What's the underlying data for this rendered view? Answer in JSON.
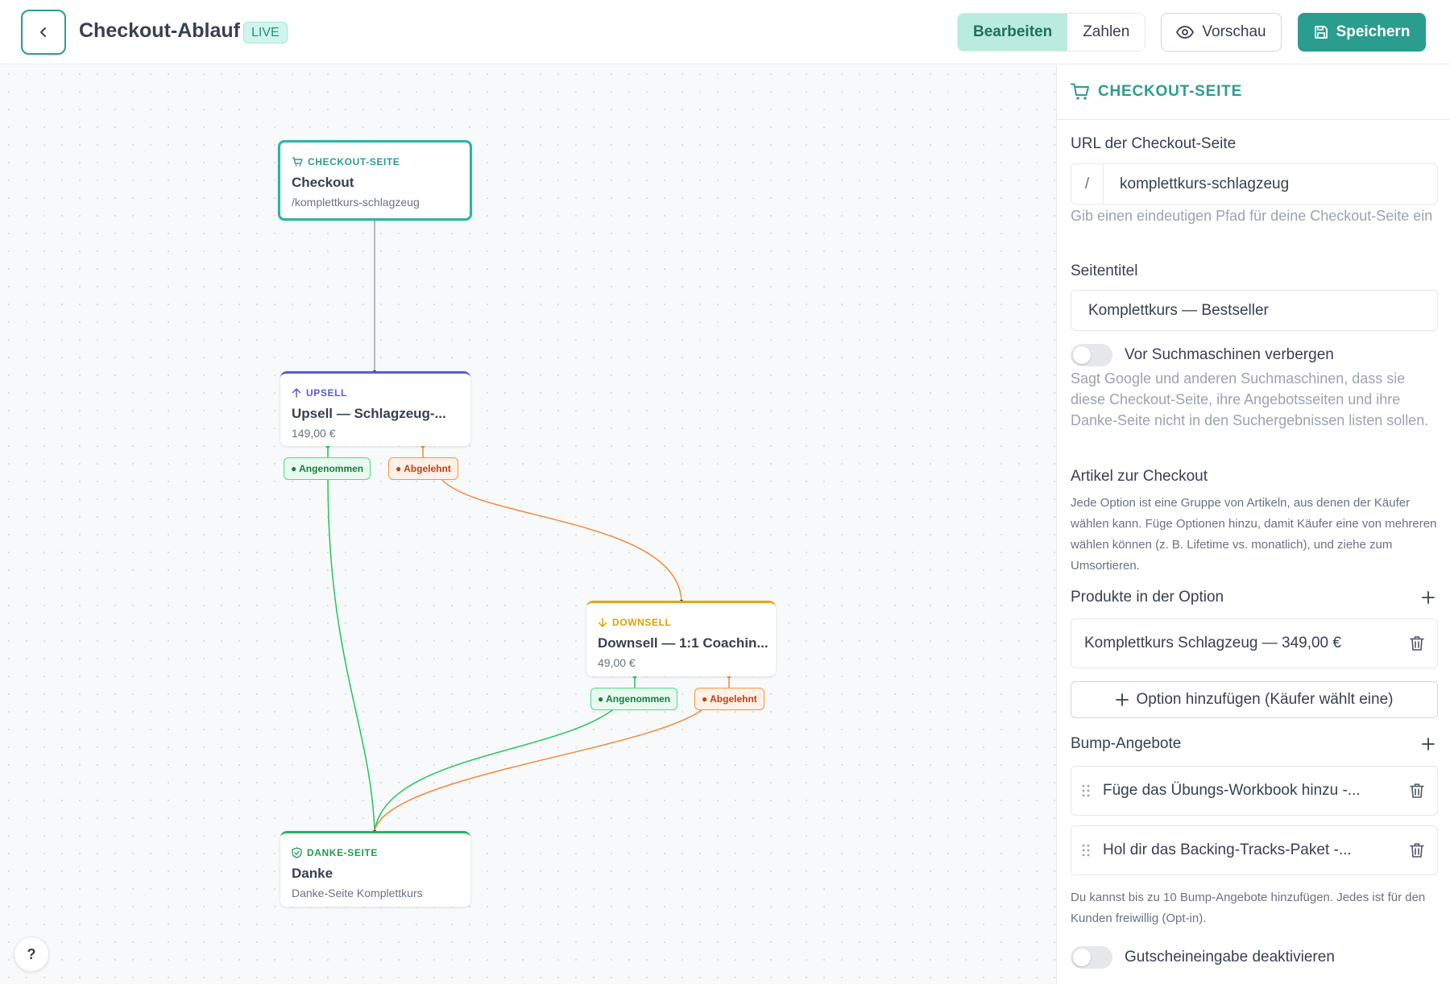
{
  "header": {
    "title": "Checkout-Ablauf",
    "badge": "LIVE",
    "tab_edit": "Bearbeiten",
    "tab_numbers": "Zahlen",
    "preview_label": "Vorschau",
    "save_label": "Speichern"
  },
  "flow": {
    "checkout": {
      "type": "CHECKOUT-SEITE",
      "name": "Checkout",
      "sub": "/komplettkurs-schlagzeug"
    },
    "upsell": {
      "type": "UPSELL",
      "name": "Upsell — Schlagzeug-...",
      "sub": "149,00 €"
    },
    "downsell": {
      "type": "DOWNSELL",
      "name": "Downsell — 1:1 Coachin...",
      "sub": "49,00 €"
    },
    "thanks": {
      "type": "DANKE-SEITE",
      "name": "Danke",
      "sub": "Danke-Seite Komplettkurs"
    },
    "accepted": "● Angenommen",
    "declined": "● Abgelehnt",
    "help": "?"
  },
  "panel": {
    "title": "CHECKOUT-SEITE",
    "url_label": "URL der Checkout-Seite",
    "url_prefix": "/",
    "url_value": "komplettkurs-schlagzeug",
    "url_help": "Gib einen eindeutigen Pfad für deine Checkout-Seite ein",
    "title_label": "Seitentitel",
    "title_value": "Komplettkurs — Bestseller",
    "seo_toggle": "Vor Suchmaschinen verbergen",
    "seo_help": "Sagt Google und anderen Suchmaschinen, dass sie diese Checkout-Seite, ihre Angebotsseiten und ihre Danke-Seite nicht in den Suchergebnissen listen sollen.",
    "items_label": "Artikel zur Checkout",
    "items_help": "Jede Option ist eine Gruppe von Artikeln, aus denen der Käufer wählen kann. Füge Optionen hinzu, damit Käufer eine von mehreren wählen können (z. B. Lifetime vs. monatlich), und ziehe zum Umsortieren.",
    "products_label": "Produkte in der Option",
    "product_item": "Komplettkurs Schlagzeug — 349,00 €",
    "add_option": "Option hinzufügen (Käufer wählt eine)",
    "bumps_label": "Bump-Angebote",
    "bumps": [
      "Füge das Übungs-Workbook hinzu -...",
      "Hol dir das Backing-Tracks-Paket -..."
    ],
    "bumps_help": "Du kannst bis zu 10 Bump-Angebote hinzufügen. Jedes ist für den Kunden freiwillig (Opt-in).",
    "coupon_toggle": "Gutscheineingabe deaktivieren"
  },
  "colors": {
    "brand": "#2a9d8f",
    "upsell": "#5b5bd6",
    "downsell": "#e8a317",
    "thanks": "#22b35e",
    "accepted": "#22c55e",
    "declined": "#f08a3c"
  }
}
